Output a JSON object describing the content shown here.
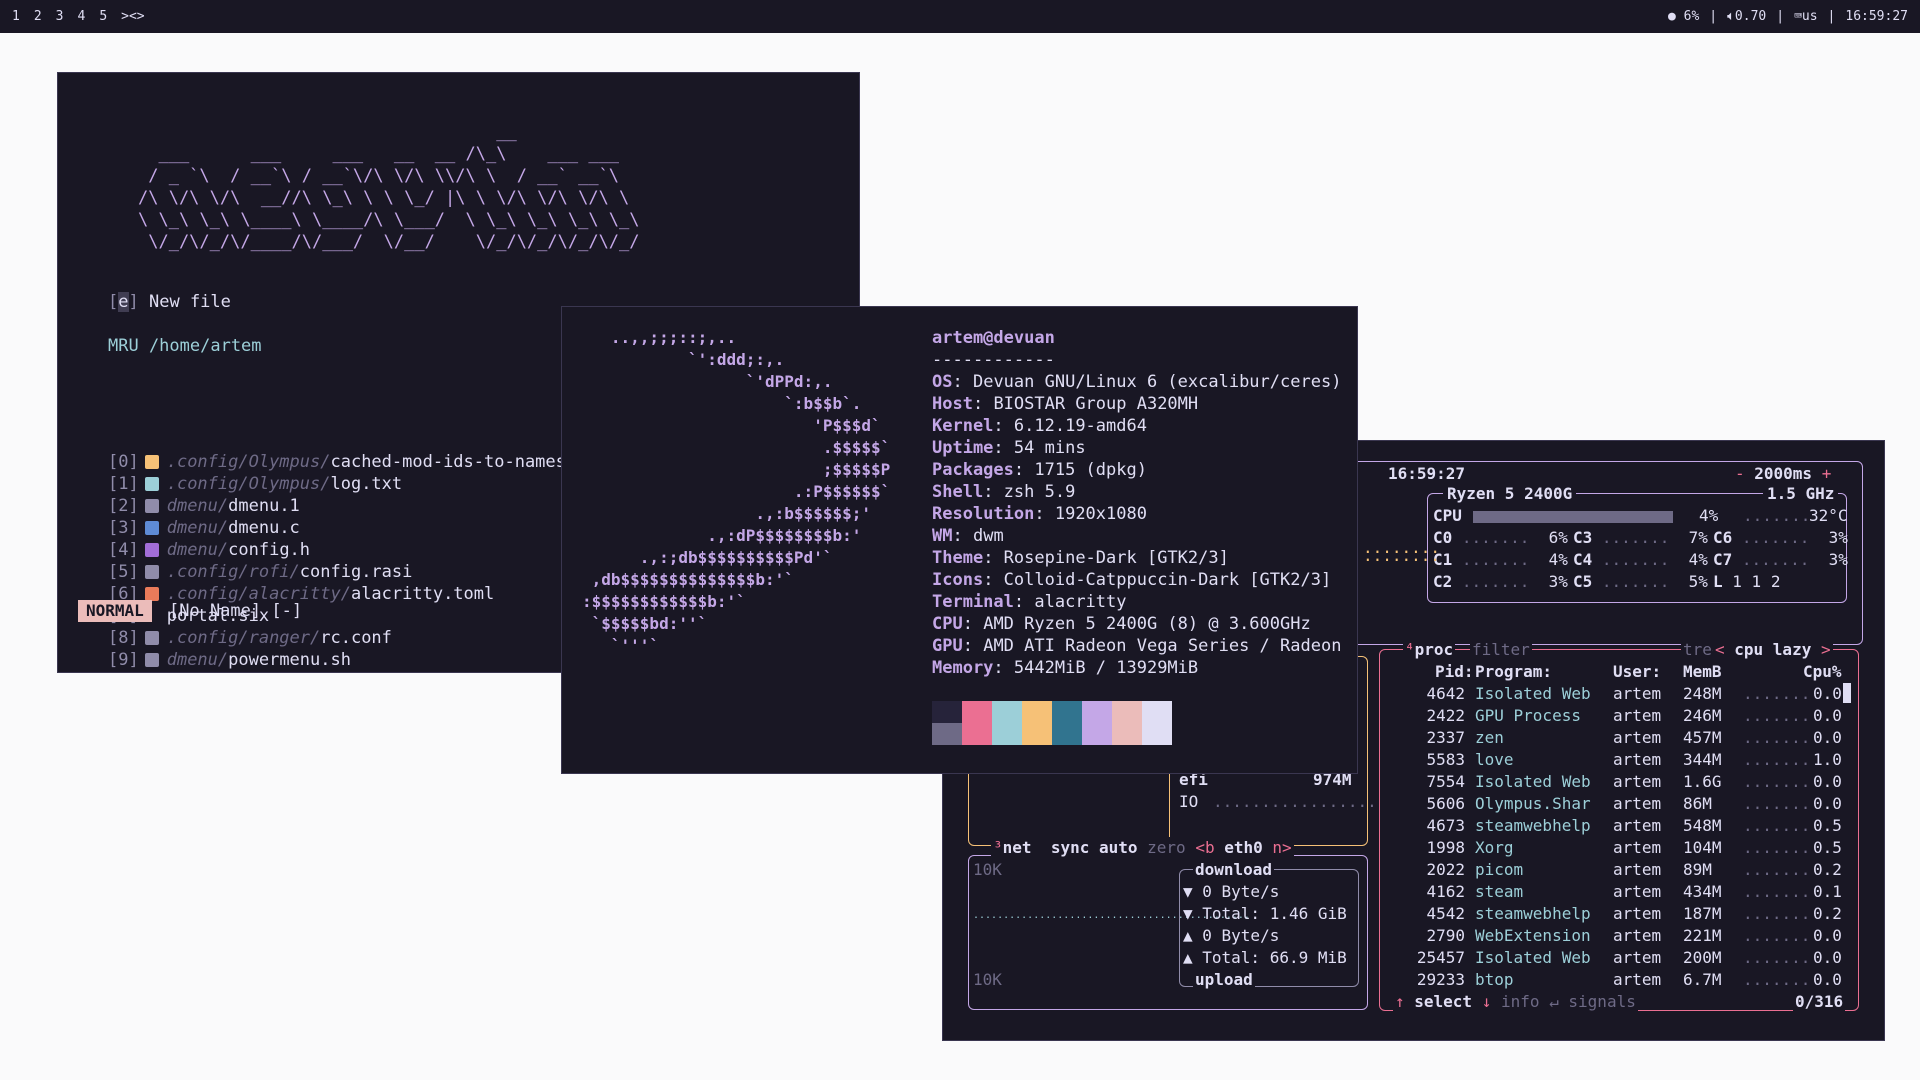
{
  "bar": {
    "tags": [
      "1",
      "2",
      "3",
      "4",
      "5"
    ],
    "layout": "><>",
    "cpu": "6%",
    "volume": "0.70",
    "kbd": "us",
    "clock": "16:59:27"
  },
  "nvim": {
    "logo": "                                   __\n  ___      ___     ___   __  __ /\\_\\    ___ ___\n / _ `\\  / __`\\ / __`\\/\\ \\/\\ \\\\/\\ \\  / __` __`\\\n/\\ \\/\\ \\/\\  __//\\ \\_\\ \\ \\ \\_/ |\\ \\ \\/\\ \\/\\ \\/\\ \\\n\\ \\_\\ \\_\\ \\____\\ \\____/\\ \\___/  \\ \\_\\ \\_\\ \\_\\ \\_\\\n \\/_/\\/_/\\/____/\\/___/  \\/__/    \\/_/\\/_/\\/_/\\/_/",
    "new_file_key": "e",
    "new_file_label": "New file",
    "mru_label": "MRU /home/artem",
    "files": [
      {
        "idx": "[0]",
        "dir": ".config/Olympus/",
        "name": "cached-mod-ids-to-names",
        "icon": "json-icon",
        "color": "#f6c177"
      },
      {
        "idx": "[1]",
        "dir": ".config/Olympus/",
        "name": "log.txt",
        "icon": "text-file-icon",
        "color": "#9ccfd8"
      },
      {
        "idx": "[2]",
        "dir": "dmenu/",
        "name": "dmenu.1",
        "icon": "doc-icon",
        "color": "#908caa"
      },
      {
        "idx": "[3]",
        "dir": "dmenu/",
        "name": "dmenu.c",
        "icon": "c-lang-icon",
        "color": "#5e8bd6"
      },
      {
        "idx": "[4]",
        "dir": "dmenu/",
        "name": "config.h",
        "icon": "header-file-icon",
        "color": "#a26dd8"
      },
      {
        "idx": "[5]",
        "dir": ".config/rofi/",
        "name": "config.rasi",
        "icon": "doc-icon",
        "color": "#908caa"
      },
      {
        "idx": "[6]",
        "dir": ".config/alacritty/",
        "name": "alacritty.toml",
        "icon": "toml-icon",
        "color": "#ea7b5a"
      },
      {
        "idx": "[7]",
        "dir": "",
        "name": "portal.six",
        "icon": "",
        "color": ""
      },
      {
        "idx": "[8]",
        "dir": ".config/ranger/",
        "name": "rc.conf",
        "icon": "gear-icon",
        "color": "#908caa"
      },
      {
        "idx": "[9]",
        "dir": "dmenu/",
        "name": "powermenu.sh",
        "icon": "shell-icon",
        "color": "#908caa"
      }
    ],
    "mode": "NORMAL",
    "buffer": "[No Name] [-]"
  },
  "neofetch": {
    "art": "   ..,,;;;::;,..\n           `':ddd;:,.\n                 `'dPPd:,.\n                     `:b$$b`.\n                        'P$$$d`\n                         .$$$$$`\n                         ;$$$$$P\n                      .:P$$$$$$`\n                  .,:b$$$$$$;'\n             .,:dP$$$$$$$$b:'\n      .,:;db$$$$$$$$$$Pd'`\n ,db$$$$$$$$$$$$$$b:'`\n:$$$$$$$$$$$$b:'`\n `$$$$$bd:''`\n   `'''`",
    "user": "artem@devuan",
    "underline": "------------",
    "fields": [
      {
        "k": "OS",
        "v": "Devuan GNU/Linux 6 (excalibur/ceres)"
      },
      {
        "k": "Host",
        "v": "BIOSTAR Group A320MH"
      },
      {
        "k": "Kernel",
        "v": "6.12.19-amd64"
      },
      {
        "k": "Uptime",
        "v": "54 mins"
      },
      {
        "k": "Packages",
        "v": "1715 (dpkg)"
      },
      {
        "k": "Shell",
        "v": "zsh 5.9"
      },
      {
        "k": "Resolution",
        "v": "1920x1080"
      },
      {
        "k": "WM",
        "v": "dwm"
      },
      {
        "k": "Theme",
        "v": "Rosepine-Dark [GTK2/3]"
      },
      {
        "k": "Icons",
        "v": "Colloid-Catppuccin-Dark [GTK2/3]"
      },
      {
        "k": "Terminal",
        "v": "alacritty"
      },
      {
        "k": "CPU",
        "v": "AMD Ryzen 5 2400G (8) @ 3.600GHz"
      },
      {
        "k": "GPU",
        "v": "AMD ATI Radeon Vega Series / Radeon"
      },
      {
        "k": "Memory",
        "v": "5442MiB / 13929MiB"
      }
    ],
    "palette": [
      "#26233a",
      "#eb6f92",
      "#9ccfd8",
      "#f6c177",
      "#31748f",
      "#c4a7e7",
      "#ebbcba",
      "#e0def4"
    ],
    "palette_bottom0": "#6e6a86"
  },
  "btop": {
    "clock": "16:59:27",
    "interval": "2000ms",
    "cpu_model": "Ryzen 5 2400G",
    "freq": "1.5 GHz",
    "cpu_label": "CPU",
    "cpu_pct": "4%",
    "cpu_temp": "32°C",
    "cpu_level": 0.04,
    "cores": [
      {
        "n": "C0",
        "p": "6%"
      },
      {
        "n": "C3",
        "p": "7%"
      },
      {
        "n": "C6",
        "p": "3%"
      },
      {
        "n": "C1",
        "p": "4%"
      },
      {
        "n": "C4",
        "p": "4%"
      },
      {
        "n": "C7",
        "p": "3%"
      },
      {
        "n": "C2",
        "p": "3%"
      },
      {
        "n": "C5",
        "p": "5%"
      },
      {
        "n": "L",
        "p": "1 1 2"
      }
    ],
    "disk_efi": "efi",
    "disk_efi_size": "974M",
    "disk_io": "IO",
    "net": {
      "title": "net",
      "sync": "sync",
      "auto": "auto",
      "zero": "zero",
      "b": "<b",
      "iface": "eth0",
      "n": "n>",
      "scale_top": "10K",
      "scale_bottom": "10K",
      "download": "download",
      "dl_rate": "▼ 0 Byte/s",
      "dl_total": "▼ Total: 1.46 GiB",
      "ul_rate": "▲ 0 Byte/s",
      "ul_total": "▲ Total: 66.9 MiB",
      "upload": "upload"
    },
    "proc": {
      "title": "proc",
      "filter": "filter",
      "tree": "tree",
      "sort": "cpu lazy",
      "headers": [
        "Pid:",
        "Program:",
        "User:",
        "MemB",
        "Cpu%"
      ],
      "rows": [
        [
          "4642",
          "Isolated Web",
          "artem",
          "248M",
          "0.0"
        ],
        [
          "2422",
          "GPU Process",
          "artem",
          "246M",
          "0.0"
        ],
        [
          "2337",
          "zen",
          "artem",
          "457M",
          "0.0"
        ],
        [
          "5583",
          "love",
          "artem",
          "344M",
          "1.0"
        ],
        [
          "7554",
          "Isolated Web",
          "artem",
          "1.6G",
          "0.0"
        ],
        [
          "5606",
          "Olympus.Shar",
          "artem",
          "86M",
          "0.0"
        ],
        [
          "4673",
          "steamwebhelp",
          "artem",
          "548M",
          "0.5"
        ],
        [
          "1998",
          "Xorg",
          "artem",
          "104M",
          "0.5"
        ],
        [
          "2022",
          "picom",
          "artem",
          "89M",
          "0.2"
        ],
        [
          "4162",
          "steam",
          "artem",
          "434M",
          "0.1"
        ],
        [
          "4542",
          "steamwebhelp",
          "artem",
          "187M",
          "0.2"
        ],
        [
          "2790",
          "WebExtension",
          "artem",
          "221M",
          "0.0"
        ],
        [
          "25457",
          "Isolated Web",
          "artem",
          "200M",
          "0.0"
        ],
        [
          "29233",
          "btop",
          "artem",
          "6.7M",
          "0.0"
        ]
      ],
      "select": "select",
      "info": "info",
      "signals": "signals",
      "count": "0/316"
    }
  }
}
